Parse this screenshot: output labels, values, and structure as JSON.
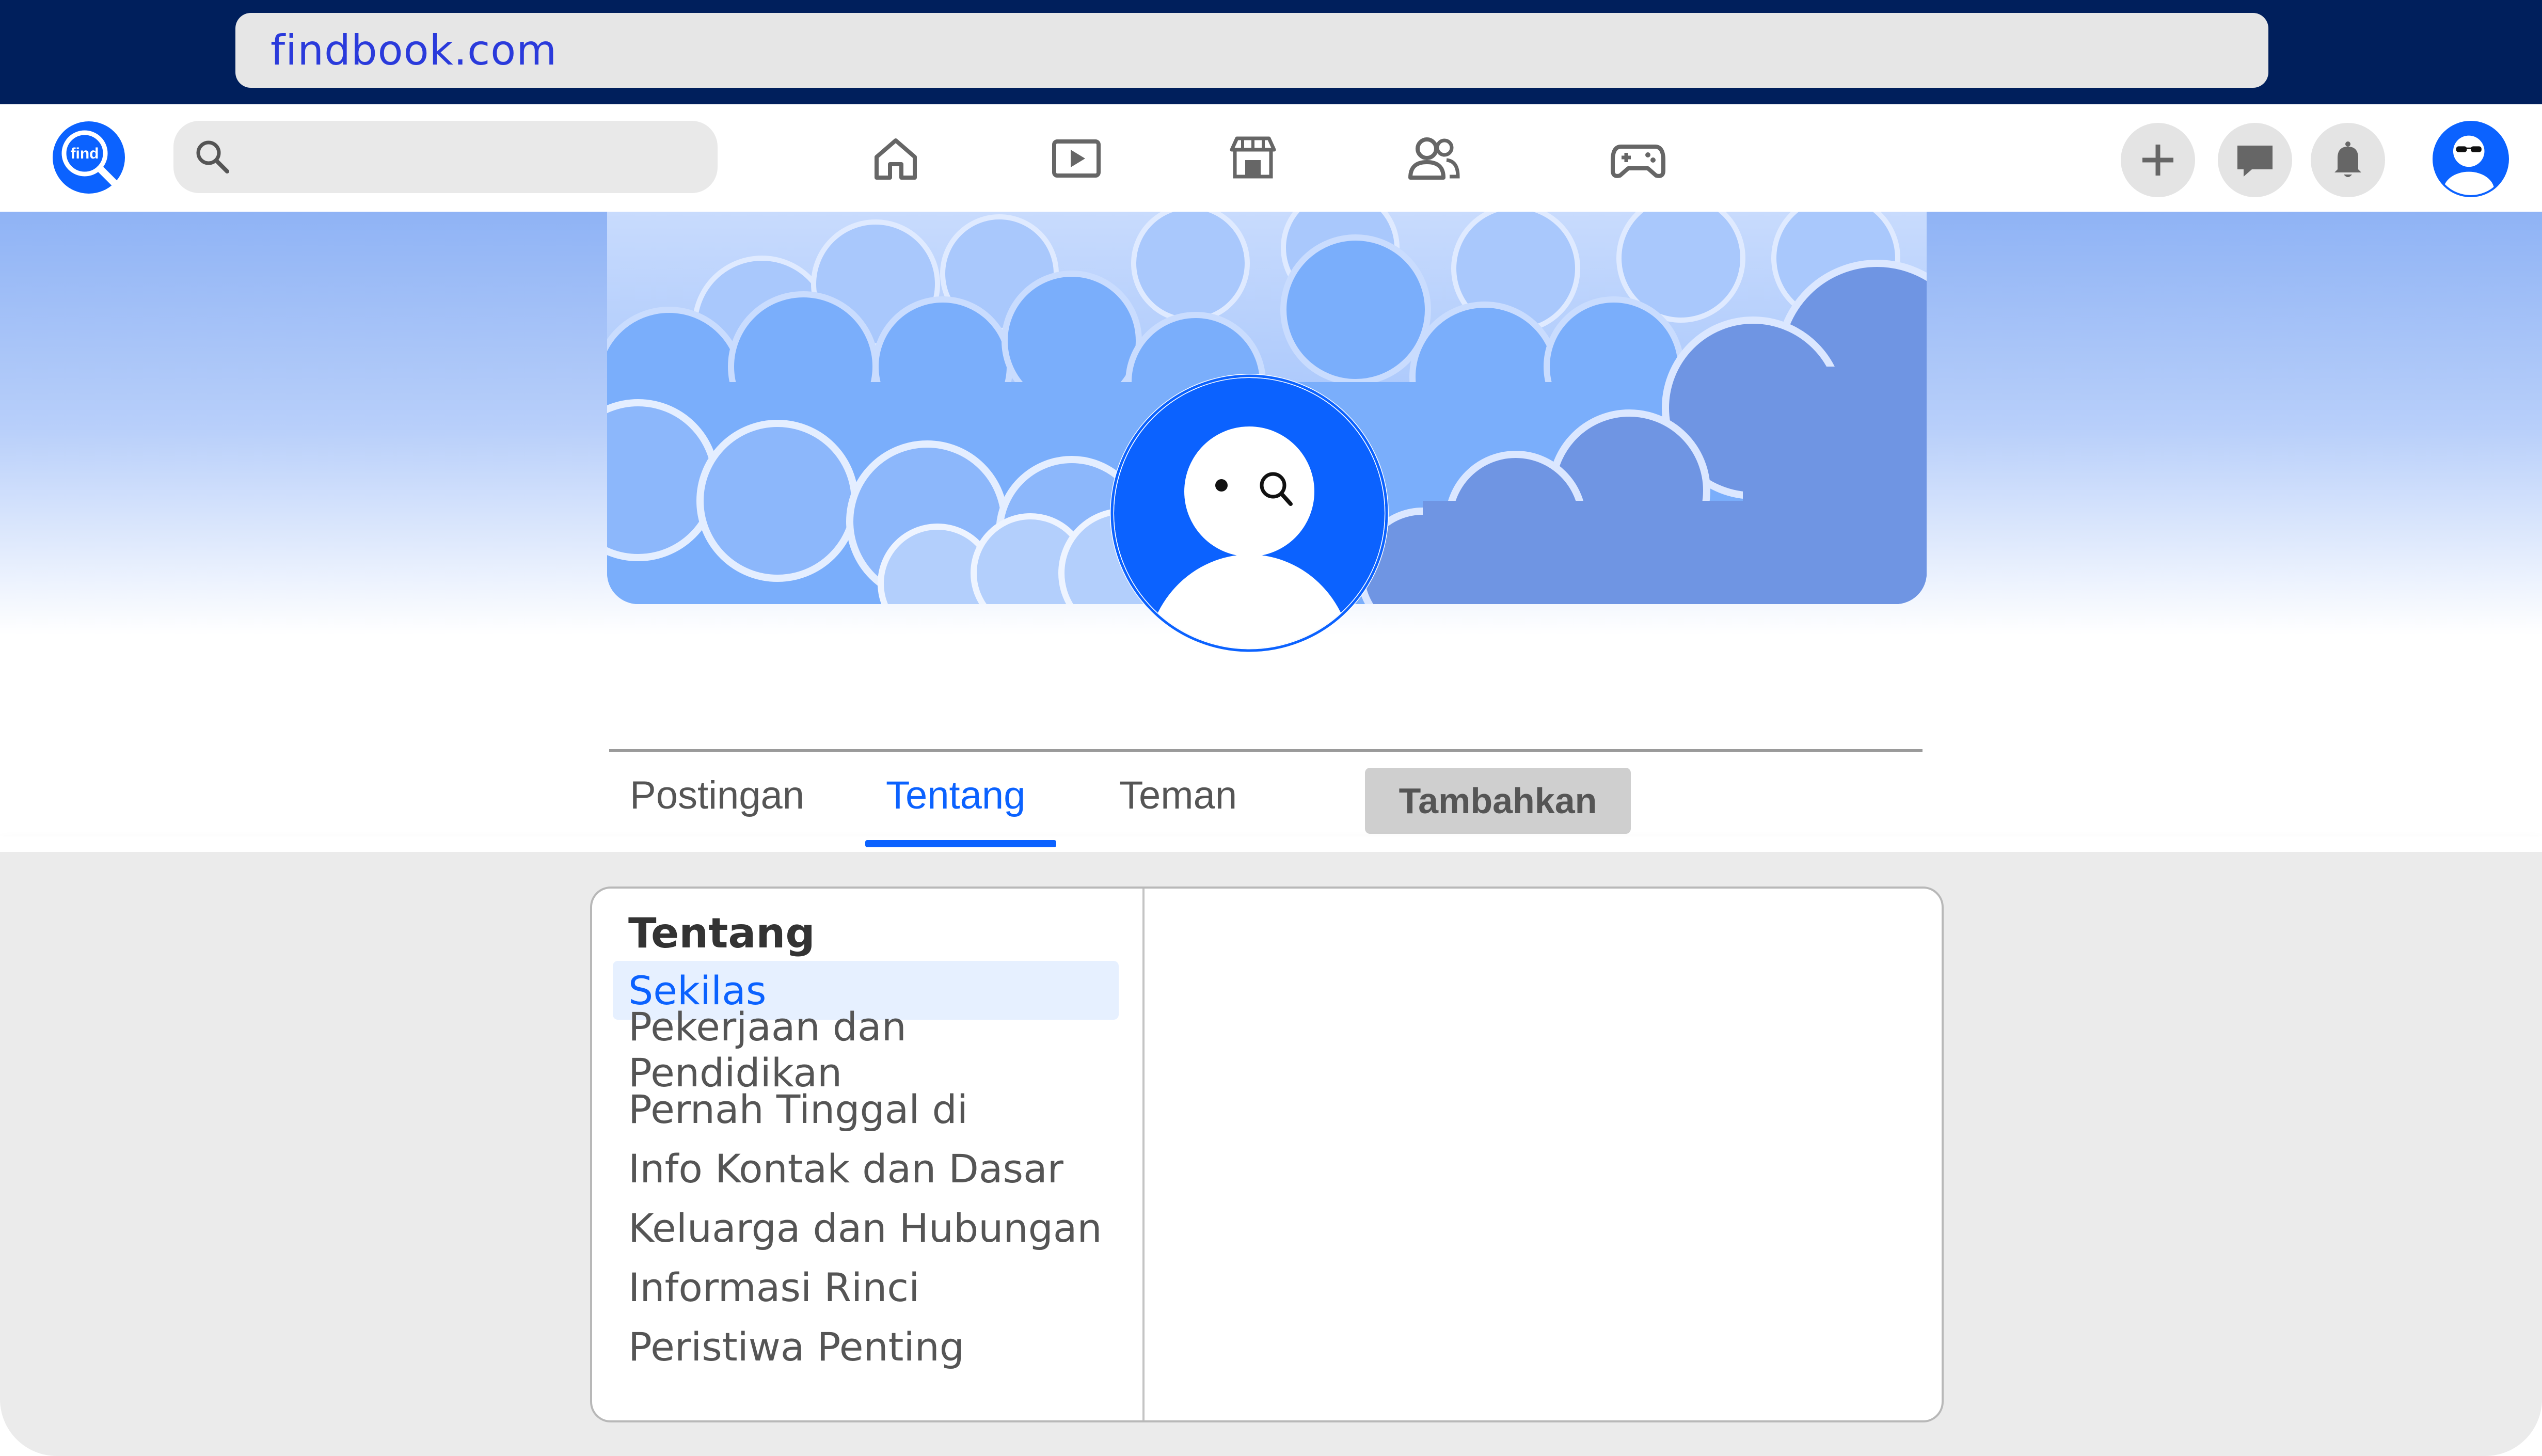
{
  "browser": {
    "url": "findbook.com"
  },
  "nav": {
    "logo_text": "find",
    "icons": [
      "home-icon",
      "video-icon",
      "marketplace-icon",
      "friends-icon",
      "gaming-icon"
    ],
    "actions": [
      "add-icon",
      "messenger-icon",
      "notification-icon"
    ]
  },
  "profile": {
    "tabs": [
      {
        "label": "Postingan",
        "active": false
      },
      {
        "label": "Tentang",
        "active": true
      },
      {
        "label": "Teman",
        "active": false
      }
    ],
    "add_button": "Tambahkan"
  },
  "about": {
    "title": "Tentang",
    "items": [
      {
        "label": "Sekilas",
        "selected": true
      },
      {
        "label": "Pekerjaan dan Pendidikan",
        "selected": false
      },
      {
        "label": "Pernah Tinggal di",
        "selected": false
      },
      {
        "label": "Info Kontak dan Dasar",
        "selected": false
      },
      {
        "label": "Keluarga dan Hubungan",
        "selected": false
      },
      {
        "label": "Informasi Rinci",
        "selected": false
      },
      {
        "label": "Peristiwa Penting",
        "selected": false
      }
    ]
  },
  "colors": {
    "brand": "#0b62ff",
    "browser_bar": "#001f5c",
    "url_text": "#2a3adb"
  }
}
